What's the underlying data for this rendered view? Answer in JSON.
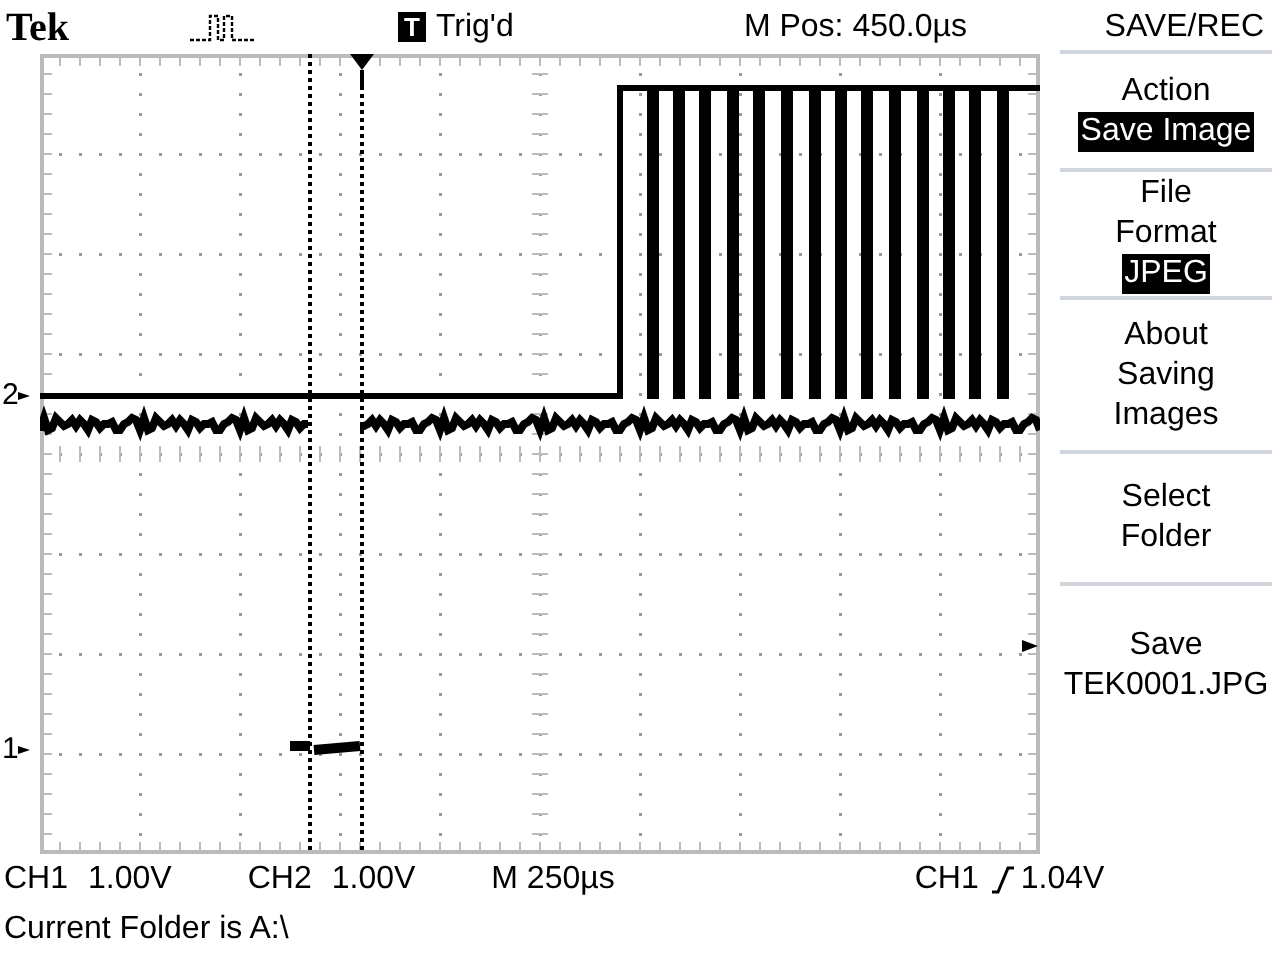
{
  "header": {
    "brand": "Tek",
    "trigger_icon": "T",
    "trigger_status": "Trig'd",
    "position": "M Pos: 450.0µs",
    "menu_title": "SAVE/REC"
  },
  "markers": [
    {
      "label": "2",
      "kind": "ch2"
    },
    {
      "label": "1",
      "kind": "ch1"
    }
  ],
  "menu": [
    {
      "label_lines": [
        "Action"
      ],
      "value": "Save Image"
    },
    {
      "label_lines": [
        "File",
        "Format"
      ],
      "value": "JPEG"
    },
    {
      "label_lines": [
        "About",
        "Saving",
        "Images"
      ]
    },
    {
      "label_lines": [
        "Select",
        "Folder"
      ]
    },
    {
      "label_lines": [
        "Save",
        "TEK0001.JPG"
      ]
    }
  ],
  "status_bar": {
    "ch1": "CH1",
    "ch1_scale": "1.00V",
    "ch2": "CH2",
    "ch2_scale": "1.00V",
    "timebase": "M 250µs",
    "trigger_source": "CH1",
    "trigger_level": "1.04V"
  },
  "message": "Current Folder is A:\\"
}
